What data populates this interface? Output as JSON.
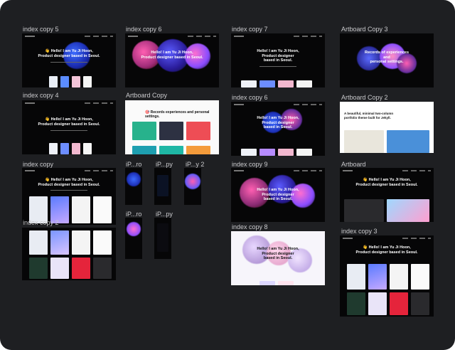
{
  "canvas": {
    "background": "#1e1f22",
    "frames": [
      {
        "id": "ic5",
        "label": "index copy 5"
      },
      {
        "id": "ic6",
        "label": "index copy 6"
      },
      {
        "id": "ic7",
        "label": "index copy 7"
      },
      {
        "id": "ac3",
        "label": "Artboard Copy 3"
      },
      {
        "id": "ic4",
        "label": "index copy 4"
      },
      {
        "id": "ac",
        "label": "Artboard Copy"
      },
      {
        "id": "ic6b",
        "label": "index copy 6"
      },
      {
        "id": "ac2",
        "label": "Artboard Copy 2"
      },
      {
        "id": "ic",
        "label": "index copy"
      },
      {
        "id": "ip1",
        "label": "iP...ro"
      },
      {
        "id": "ip2",
        "label": "iP...py"
      },
      {
        "id": "ip3",
        "label": "iP...y 2"
      },
      {
        "id": "ic9",
        "label": "index copy 9"
      },
      {
        "id": "ab",
        "label": "Artboard"
      },
      {
        "id": "ic2",
        "label": "index copy 2"
      },
      {
        "id": "ip4",
        "label": "iP...ro"
      },
      {
        "id": "ip5",
        "label": "iP...py"
      },
      {
        "id": "ic8",
        "label": "index copy 8"
      },
      {
        "id": "ic3",
        "label": "index copy 3"
      }
    ]
  },
  "hero": {
    "hello_two_line": "👋 Hello! I am Yu Ji Hoon,\nProduct designer based in Seoul.",
    "hello_plain": "Hello! I am Yu Ji Hoon,\nProduct designer based in Seoul.",
    "hello_short": "Hello! I am Yu Ji Hoon,\nProduct designer\nbased in Seoul.",
    "records": "Records of experiences\nand\npersonal settings.",
    "records_line": "🎯 Records experiences and personal settings.",
    "minimal": "A beautiful, minimal two-column\nportfolio theme built for Jekyll.",
    "hello_artboard": "👋 Hello! I am Yu Ji Hoon,\nProduct designer based in Seoul."
  },
  "colors": {
    "accent_blue": "#2f5bff",
    "accent_pink": "#ff5fb2",
    "accent_purple": "#8a4dff",
    "accent_teal": "#1fb7a5"
  }
}
